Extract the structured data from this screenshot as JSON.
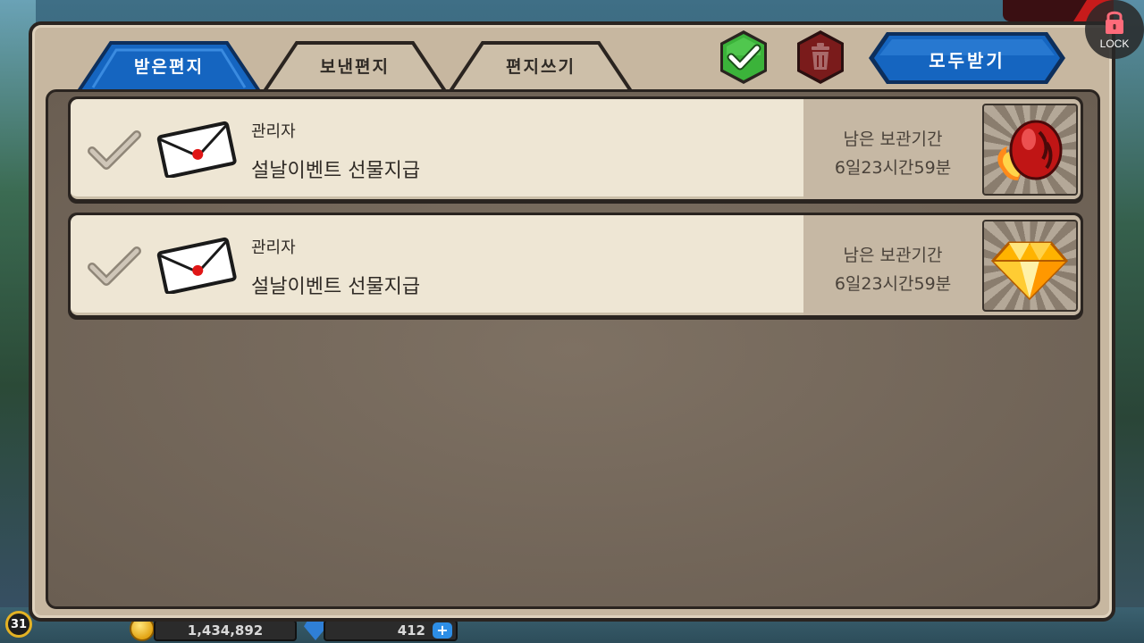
{
  "tabs": [
    {
      "label": "받은편지",
      "active": true
    },
    {
      "label": "보낸편지",
      "active": false
    },
    {
      "label": "편지쓰기",
      "active": false
    }
  ],
  "toolbar": {
    "select_all_icon": "check-icon",
    "delete_icon": "trash-icon",
    "receive_all_label": "모두받기"
  },
  "mails": [
    {
      "sender": "관리자",
      "subject": "설날이벤트 선물지급",
      "keep_label": "남은 보관기간",
      "keep_time": "6일23시간59분",
      "reward_icon": "flame-egg-icon"
    },
    {
      "sender": "관리자",
      "subject": "설날이벤트 선물지급",
      "keep_label": "남은 보관기간",
      "keep_time": "6일23시간59분",
      "reward_icon": "diamond-icon"
    }
  ],
  "hud": {
    "level": "31",
    "gold": "1,434,892",
    "gems": "412",
    "lock_label": "LOCK"
  },
  "colors": {
    "tab_active": "#1565c0",
    "tab_inactive": "#cdbfa9",
    "check_button": "#2fa62c",
    "trash_button": "#7a1b1b",
    "receive_button": "#1565c0"
  }
}
